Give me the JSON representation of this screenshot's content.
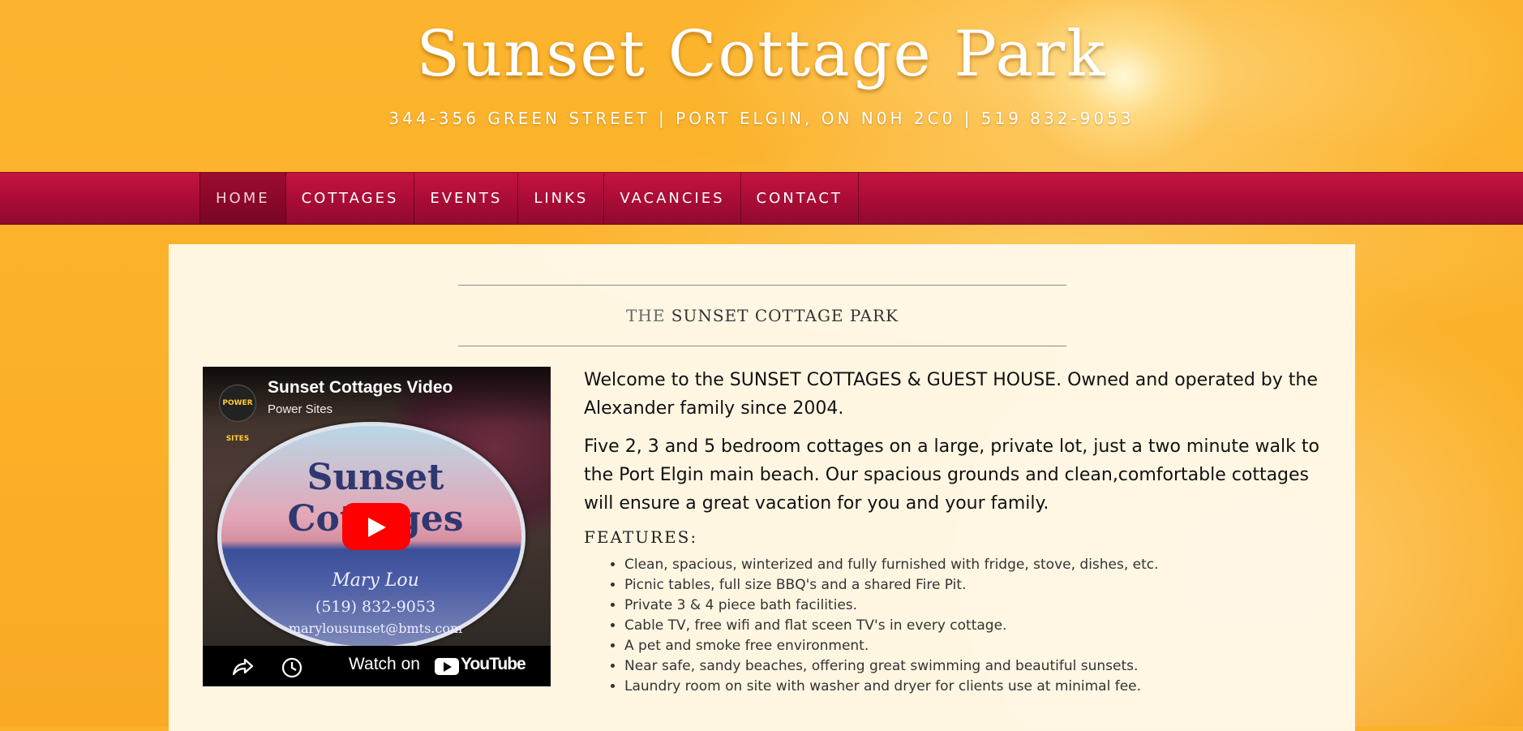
{
  "site": {
    "title": "Sunset Cottage Park",
    "subtitle": "344-356 GREEN STREET | PORT ELGIN, ON N0H 2C0 | 519 832-9053"
  },
  "nav": {
    "items": [
      {
        "label": "HOME",
        "active": true
      },
      {
        "label": "COTTAGES",
        "active": false
      },
      {
        "label": "EVENTS",
        "active": false
      },
      {
        "label": "LINKS",
        "active": false
      },
      {
        "label": "VACANCIES",
        "active": false
      },
      {
        "label": "CONTACT",
        "active": false
      }
    ]
  },
  "main": {
    "heading_prefix": "THE",
    "heading_main": "SUNSET COTTAGE PARK",
    "video": {
      "title": "Sunset Cottages Video",
      "channel": "Power Sites",
      "channel_logo_text": "POWER SITES",
      "sign_title": "Sunset Cottages",
      "sign_name": "Mary Lou",
      "sign_phone": "(519) 832-9053",
      "sign_email": "marylousunset@bmts.com",
      "watch_label": "Watch on",
      "youtube_label": "YouTube"
    },
    "paragraphs": [
      "Welcome to the SUNSET COTTAGES & GUEST HOUSE. Owned and operated by the Alexander family since 2004.",
      "Five 2, 3 and 5 bedroom cottages on a large, private lot, just a two minute walk to the Port Elgin main beach. Our spacious grounds and clean,comfortable cottages will ensure a great vacation for you and your family."
    ],
    "features_label": "FEATURES:",
    "features": [
      "Clean, spacious, winterized and fully furnished with fridge, stove, dishes, etc.",
      "Picnic tables, full size BBQ's and a shared Fire Pit.",
      "Private 3 & 4 piece bath facilities.",
      "Cable TV, free wifi and flat sceen TV's in every cottage.",
      "A pet and smoke free environment.",
      "Near safe, sandy beaches, offering great swimming and beautiful sunsets.",
      "Laundry room on site with washer and dryer for clients use at minimal fee."
    ]
  },
  "colors": {
    "background": "#fbb12a",
    "nav": "#a90c36",
    "content_bg": "#fff9ea",
    "youtube_red": "#ff0000"
  }
}
